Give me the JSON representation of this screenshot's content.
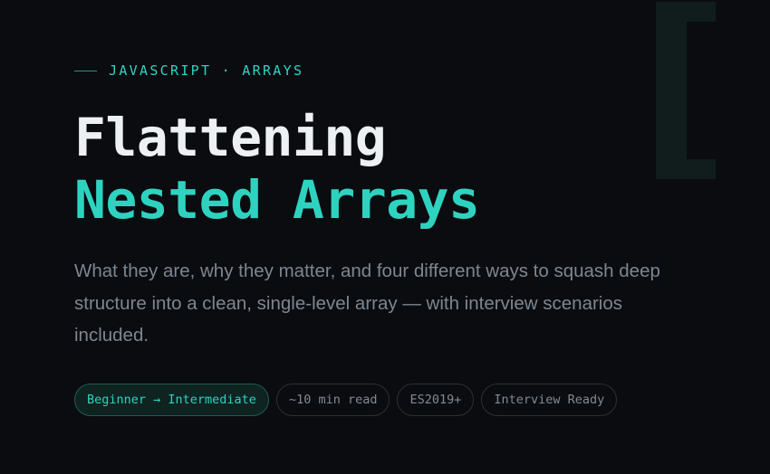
{
  "eyebrow": {
    "category": "JAVASCRIPT",
    "separator": "·",
    "topic": "ARRAYS",
    "text": "JAVASCRIPT · ARRAYS"
  },
  "title": {
    "line1": "Flattening",
    "line2": "Nested Arrays"
  },
  "description": "What they are, why they matter, and four different ways to squash deep structure into a clean, single-level array — with interview scenarios included.",
  "tags": [
    {
      "label": "Beginner → Intermediate",
      "accent": true
    },
    {
      "label": "~10 min read",
      "accent": false
    },
    {
      "label": "ES2019+",
      "accent": false
    },
    {
      "label": "Interview Ready",
      "accent": false
    }
  ],
  "colors": {
    "background": "#0a0c10",
    "accent": "#2ed3c0",
    "heading": "#eef1f4",
    "muted": "#7d8690",
    "decorative_bracket": "#101d1c"
  },
  "decorative_glyph": "["
}
